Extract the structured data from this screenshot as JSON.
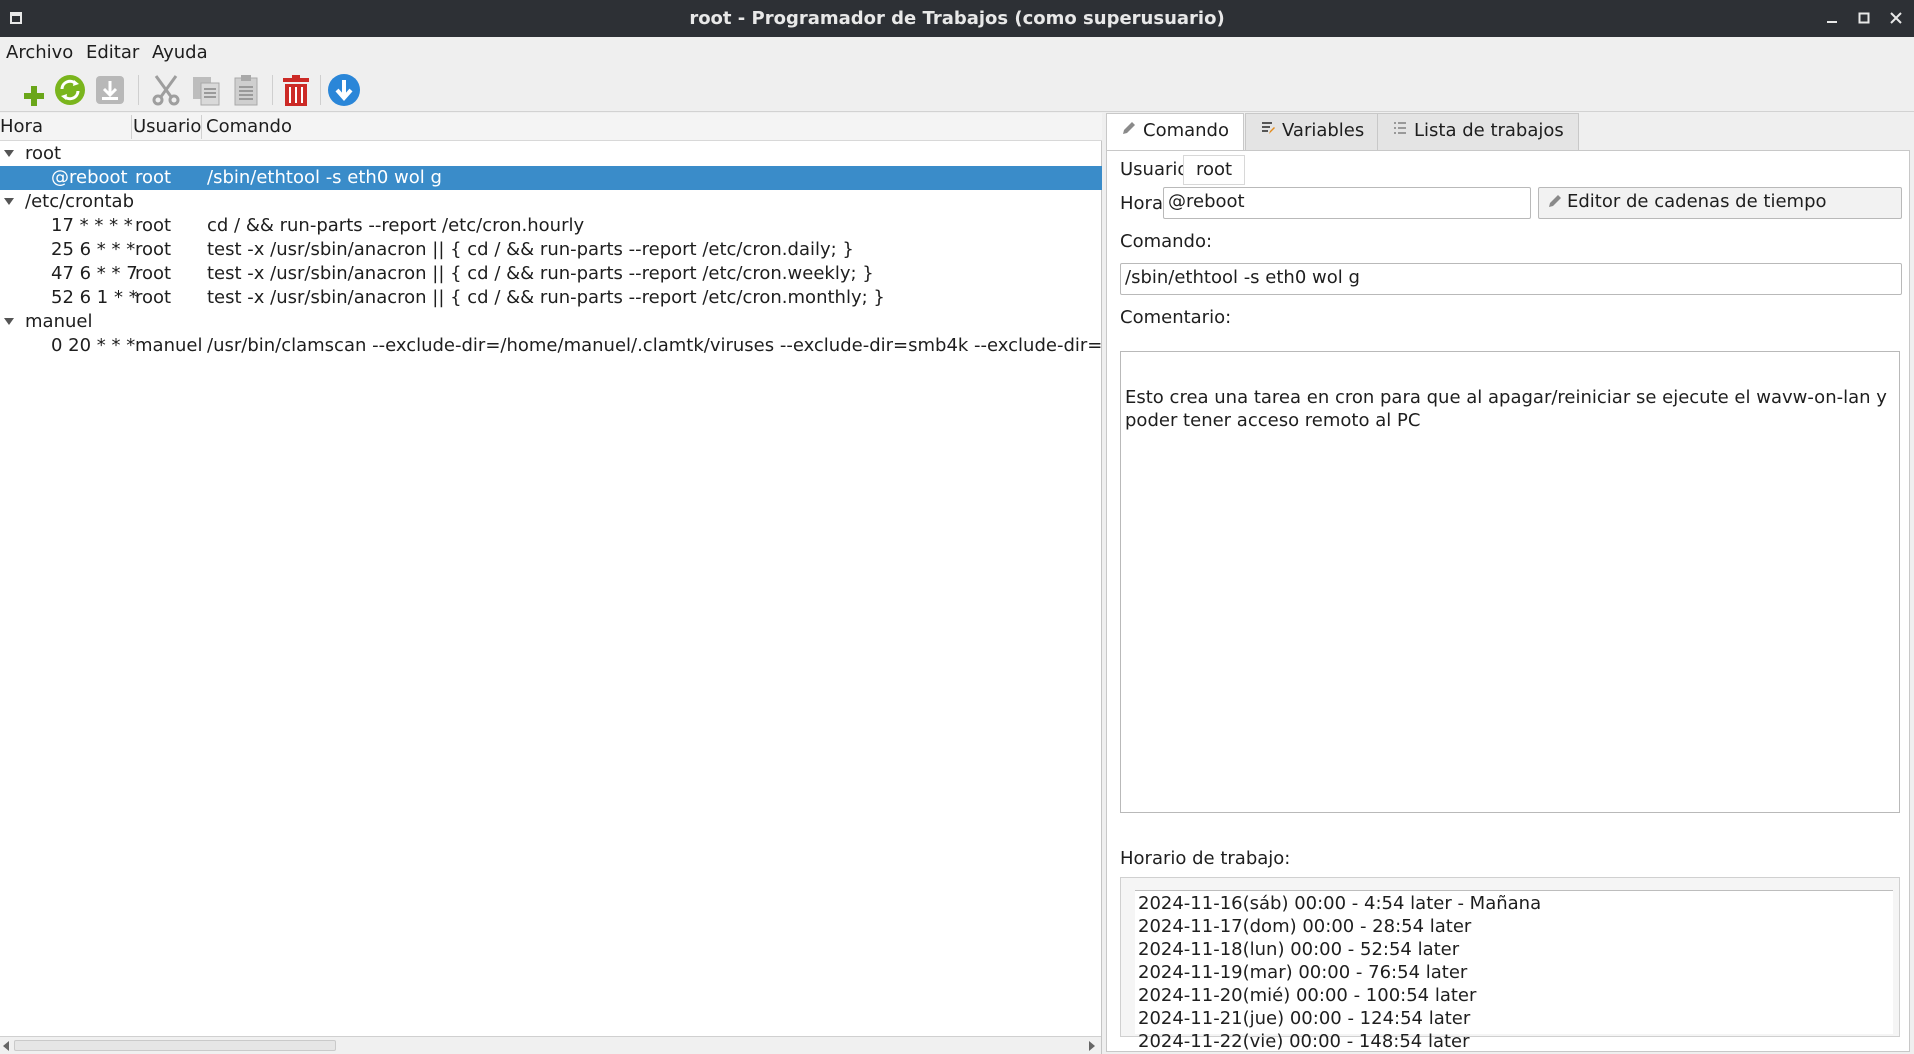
{
  "window": {
    "title": "root - Programador de Trabajos (como superusuario)",
    "buttons": [
      "minimize",
      "maximize",
      "close"
    ]
  },
  "menu": [
    "Archivo",
    "Editar",
    "Ayuda"
  ],
  "toolbar": [
    {
      "name": "add-icon"
    },
    {
      "name": "refresh-icon"
    },
    {
      "name": "save-icon"
    },
    {
      "name": "cut-icon"
    },
    {
      "name": "copy-icon"
    },
    {
      "name": "paste-icon"
    },
    {
      "name": "delete-icon"
    },
    {
      "name": "download-icon"
    }
  ],
  "colors": {
    "selection": "#3a8cc9",
    "titlebar": "#2d3035",
    "add_green": "#6aa619",
    "refresh_green": "#7ab51d",
    "delete_red": "#cc2a26",
    "download_blue": "#2a86d8"
  },
  "tree": {
    "columns": [
      "Hora",
      "Usuario",
      "Comando"
    ],
    "groups": [
      {
        "name": "root",
        "rows": [
          {
            "time": "@reboot",
            "user": "root",
            "command": "/sbin/ethtool -s eth0 wol g",
            "selected": true
          }
        ]
      },
      {
        "name": "/etc/crontab",
        "rows": [
          {
            "time": "17 * * * *",
            "user": "root",
            "command": "cd / && run-parts --report /etc/cron.hourly"
          },
          {
            "time": "25 6 * * *",
            "user": "root",
            "command": "test -x /usr/sbin/anacron || { cd / && run-parts --report /etc/cron.daily; }"
          },
          {
            "time": "47 6 * * 7",
            "user": "root",
            "command": "test -x /usr/sbin/anacron || { cd / && run-parts --report /etc/cron.weekly; }"
          },
          {
            "time": "52 6 1 * *",
            "user": "root",
            "command": "test -x /usr/sbin/anacron || { cd / && run-parts --report /etc/cron.monthly; }"
          }
        ]
      },
      {
        "name": "manuel",
        "rows": [
          {
            "time": "0 20 * * *",
            "user": "manuel",
            "command": "/usr/bin/clamscan --exclude-dir=/home/manuel/.clamtk/viruses --exclude-dir=smb4k --exclude-dir=/run/u"
          }
        ]
      }
    ]
  },
  "tabs": [
    {
      "label": "Comando",
      "active": true
    },
    {
      "label": "Variables",
      "active": false
    },
    {
      "label": "Lista de trabajos",
      "active": false
    }
  ],
  "form": {
    "user_label": "Usuario:",
    "user_value": "root",
    "time_label": "Hora:",
    "time_value": "@reboot",
    "time_editor_button": "Editor de cadenas de tiempo",
    "command_label": "Comando:",
    "command_value": "/sbin/ethtool -s eth0 wol g",
    "comment_label": "Comentario:",
    "comment_value": "Esto crea una tarea en cron para que al apagar/reiniciar se ejecute el wavw-on-lan y poder tener acceso remoto al PC",
    "schedule_label": "Horario de trabajo:",
    "schedule": [
      "2024-11-16(sáb) 00:00 - 4:54 later - Mañana",
      "2024-11-17(dom) 00:00 - 28:54 later",
      "2024-11-18(lun) 00:00 - 52:54 later",
      "2024-11-19(mar) 00:00 - 76:54 later",
      "2024-11-20(mié) 00:00 - 100:54 later",
      "2024-11-21(jue) 00:00 - 124:54 later",
      "2024-11-22(vie) 00:00 - 148:54 later"
    ]
  }
}
